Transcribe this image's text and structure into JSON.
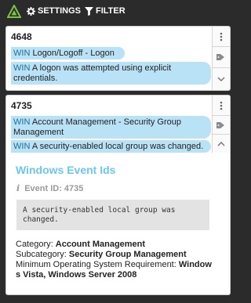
{
  "toolbar": {
    "settings_label": "SETTINGS",
    "filter_label": "FILTER",
    "accent": "#7cc243"
  },
  "events": [
    {
      "id": "4648",
      "category_chip": {
        "prefix": "WIN",
        "text": "Logon/Logoff - Logon"
      },
      "description_chip": {
        "prefix": "WIN",
        "text": "A logon was attempted using explicit credentials."
      }
    },
    {
      "id": "4735",
      "category_chip": {
        "prefix": "WIN",
        "text": "Account Management - Security Group Management"
      },
      "description_chip": {
        "prefix": "WIN",
        "text": "A security-enabled local group was changed."
      },
      "details": {
        "title": "Windows Event Ids",
        "event_id_label": "Event ID: 4735",
        "description": "A security-enabled local group was changed.",
        "category_label": "Category:",
        "category_value": "Account Management",
        "subcategory_label": "Subcategory:",
        "subcategory_value": "Security Group Management",
        "min_os_label": "Minimum Operating System Requirement:",
        "min_os_value": "Windows Vista, Windows Server 2008"
      }
    }
  ],
  "colors": {
    "chip_bg": "#b9e2f6",
    "details_title": "#6cc7ef",
    "background": "#2b2b2b"
  }
}
